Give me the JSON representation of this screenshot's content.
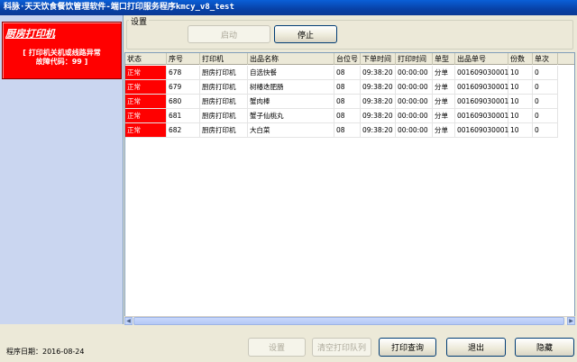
{
  "window": {
    "title": "科脉·天天饮食餐饮管理软件-端口打印服务程序kmcy_v8_test"
  },
  "alarm": {
    "title": "厨房打印机",
    "message_line1": "[ 打印机关机或线路异常",
    "message_line2": "故障代码：99 ]"
  },
  "settings": {
    "label": "设置",
    "start_label": "启动",
    "stop_label": "停止"
  },
  "table": {
    "columns": [
      "状态",
      "序号",
      "打印机",
      "出品名称",
      "台位号",
      "下单时间",
      "打印时间",
      "单型",
      "出品单号",
      "份数",
      "单次"
    ],
    "rows": [
      [
        "正常",
        "678",
        "厨房打印机",
        "自选快餐",
        "08",
        "09:38:20",
        "00:00:00",
        "分单",
        "001609030001",
        "10",
        "0"
      ],
      [
        "正常",
        "679",
        "厨房打印机",
        "树椿迭肥肠",
        "08",
        "09:38:20",
        "00:00:00",
        "分单",
        "001609030001",
        "10",
        "0"
      ],
      [
        "正常",
        "680",
        "厨房打印机",
        "蟹肉棒",
        "08",
        "09:38:20",
        "00:00:00",
        "分单",
        "001609030001",
        "10",
        "0"
      ],
      [
        "正常",
        "681",
        "厨房打印机",
        "蟹子仙桃丸",
        "08",
        "09:38:20",
        "00:00:00",
        "分单",
        "001609030001",
        "10",
        "0"
      ],
      [
        "正常",
        "682",
        "厨房打印机",
        "大白菜",
        "08",
        "09:38:20",
        "00:00:00",
        "分单",
        "001609030001",
        "10",
        "0"
      ]
    ]
  },
  "footer": {
    "program_date": "程序日期：2016-08-24",
    "settings_label": "设置",
    "clear_queue_label": "清空打印队列",
    "print_query_label": "打印查询",
    "exit_label": "退出",
    "hide_label": "隐藏"
  },
  "colors": {
    "alarm_red": "#ff0000",
    "title_blue": "#0a5fd8"
  }
}
